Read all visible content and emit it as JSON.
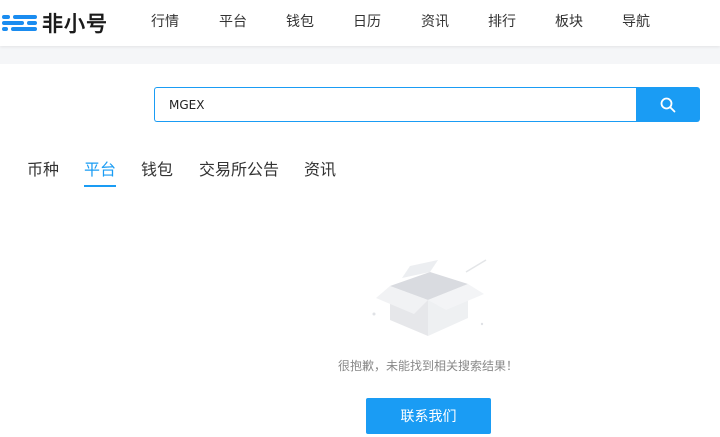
{
  "brand": {
    "name": "非小号",
    "accent": "#1a9cf4"
  },
  "nav": {
    "items": [
      {
        "label": "行情"
      },
      {
        "label": "平台"
      },
      {
        "label": "钱包"
      },
      {
        "label": "日历"
      },
      {
        "label": "资讯"
      },
      {
        "label": "排行"
      },
      {
        "label": "板块"
      },
      {
        "label": "导航"
      }
    ]
  },
  "search": {
    "value": "MGEX",
    "button_icon": "search-icon"
  },
  "tabs": {
    "items": [
      {
        "label": "币种"
      },
      {
        "label": "平台"
      },
      {
        "label": "钱包"
      },
      {
        "label": "交易所公告"
      },
      {
        "label": "资讯"
      }
    ],
    "active": "平台"
  },
  "empty": {
    "illustration_icon": "empty-box-icon",
    "message": "很抱歉，未能找到相关搜索结果！",
    "contact_label": "联系我们"
  }
}
